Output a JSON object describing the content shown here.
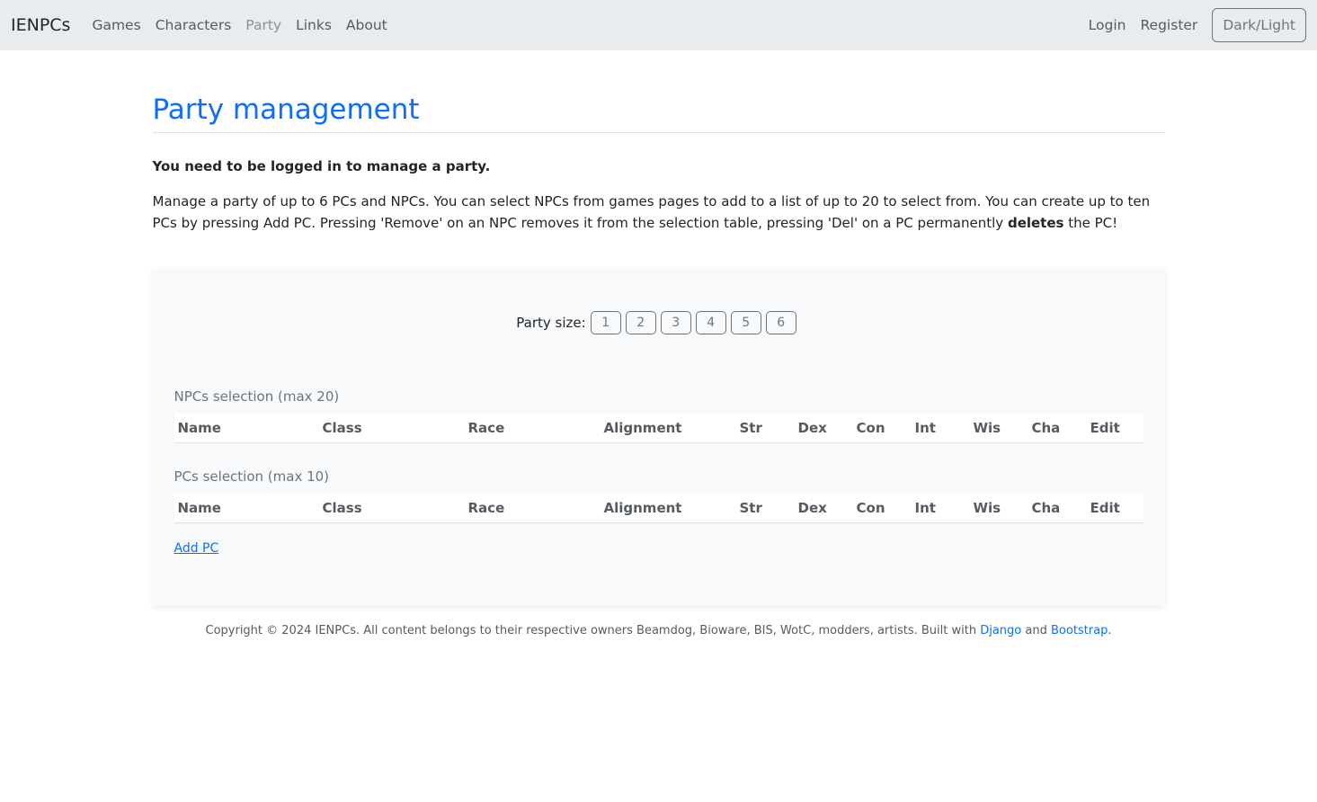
{
  "navbar": {
    "brand": "IENPCs",
    "links": [
      {
        "label": "Games",
        "active": false
      },
      {
        "label": "Characters",
        "active": false
      },
      {
        "label": "Party",
        "active": true
      },
      {
        "label": "Links",
        "active": false
      },
      {
        "label": "About",
        "active": false
      }
    ],
    "login": "Login",
    "register": "Register",
    "theme_toggle": "Dark/Light"
  },
  "page": {
    "title": "Party management",
    "login_note": "You need to be logged in to manage a party.",
    "description_part1": "Manage a party of up to 6 PCs and NPCs. You can select NPCs from games pages to add to a list of up to 20 to select from. You can create up to ten PCs by pressing Add PC. Pressing 'Remove' on an NPC removes it from the selection table, pressing 'Del' on a PC permanently ",
    "description_bold": "deletes",
    "description_part2": " the PC!"
  },
  "panel": {
    "party_size_label": "Party size:",
    "party_sizes": [
      "1",
      "2",
      "3",
      "4",
      "5",
      "6"
    ],
    "npc_section_title": "NPCs selection (max 20)",
    "pc_section_title": "PCs selection (max 10)",
    "columns": [
      "Name",
      "Class",
      "Race",
      "Alignment",
      "Str",
      "Dex",
      "Con",
      "Int",
      "Wis",
      "Cha",
      "Edit"
    ],
    "add_pc": "Add PC"
  },
  "footer": {
    "text": "Copyright © 2024 IENPCs. All content belongs to their respective owners Beamdog, Bioware, BIS, WotC, modders, artists. Built with ",
    "django": "Django",
    "and": " and ",
    "bootstrap": "Bootstrap",
    "end": "."
  },
  "colors": {
    "accent": "#0d6efd",
    "navbar_bg": "#e9ecef",
    "panel_bg": "#f8f9fa"
  }
}
